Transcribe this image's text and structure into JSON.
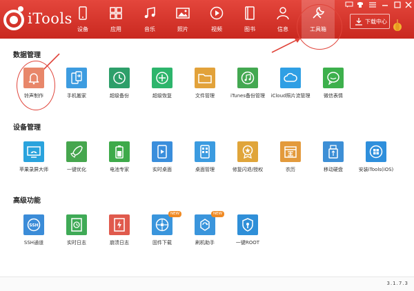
{
  "app": {
    "brand": "iTools"
  },
  "nav": [
    {
      "label": "设备",
      "icon": "device-icon"
    },
    {
      "label": "应用",
      "icon": "apps-icon"
    },
    {
      "label": "音乐",
      "icon": "music-icon"
    },
    {
      "label": "照片",
      "icon": "photo-icon"
    },
    {
      "label": "视频",
      "icon": "video-icon"
    },
    {
      "label": "图书",
      "icon": "book-icon"
    },
    {
      "label": "信息",
      "icon": "user-icon"
    },
    {
      "label": "工具箱",
      "icon": "wrench-icon",
      "active": true
    }
  ],
  "download_center": {
    "label": "下载中心"
  },
  "sections": {
    "data": {
      "title": "数据管理",
      "tiles": [
        {
          "label": "铃声制作",
          "icon": "bell-icon",
          "color": "#e8876a"
        },
        {
          "label": "手机搬家",
          "icon": "phone-transfer-icon",
          "color": "#3d9ce0"
        },
        {
          "label": "超级备份",
          "icon": "clock-backup-icon",
          "color": "#2d9f6a"
        },
        {
          "label": "超级恢复",
          "icon": "restore-icon",
          "color": "#2db56c"
        },
        {
          "label": "文件管理",
          "icon": "folder-icon",
          "color": "#e2a23a"
        },
        {
          "label": "iTunes备份管理",
          "icon": "itunes-icon",
          "color": "#43a851"
        },
        {
          "label": "iCloud照片流管理",
          "icon": "cloud-icon",
          "color": "#2f9fe4"
        },
        {
          "label": "微信表情",
          "icon": "wechat-smile-icon",
          "color": "#3db04c"
        }
      ]
    },
    "device": {
      "title": "设备管理",
      "tiles": [
        {
          "label": "苹果录屏大师",
          "icon": "screen-record-icon",
          "color": "#2aa3dd"
        },
        {
          "label": "一键优化",
          "icon": "rocket-icon",
          "color": "#46a64e"
        },
        {
          "label": "电池专家",
          "icon": "battery-icon",
          "color": "#3eaa4a"
        },
        {
          "label": "实时桌面",
          "icon": "realtime-desktop-icon",
          "color": "#3a8edc"
        },
        {
          "label": "桌面管理",
          "icon": "desktop-grid-icon",
          "color": "#3b9be0"
        },
        {
          "label": "修复闪退/授权",
          "icon": "repair-badge-icon",
          "color": "#e0a53a"
        },
        {
          "label": "农历",
          "icon": "calendar-icon",
          "color": "#e39a3c"
        },
        {
          "label": "移动硬盘",
          "icon": "usb-icon",
          "color": "#3d8fd6"
        },
        {
          "label": "安装iTools(iOS)",
          "icon": "itools-install-icon",
          "color": "#2e8fdc"
        }
      ]
    },
    "advanced": {
      "title": "高级功能",
      "tiles": [
        {
          "label": "SSH通道",
          "icon": "ssh-icon",
          "color": "#3b8cd8"
        },
        {
          "label": "实时日志",
          "icon": "log-icon",
          "color": "#3faa56"
        },
        {
          "label": "崩溃日志",
          "icon": "crash-log-icon",
          "color": "#e05a4d"
        },
        {
          "label": "固件下载",
          "icon": "firmware-icon",
          "color": "#3a95dc",
          "badge": "NEW"
        },
        {
          "label": "刷机助手",
          "icon": "flash-icon",
          "color": "#3a95dc",
          "badge": "NEW"
        },
        {
          "label": "一键ROOT",
          "icon": "root-shield-icon",
          "color": "#2f8fd8"
        }
      ]
    }
  },
  "version": "3.1.7.3"
}
